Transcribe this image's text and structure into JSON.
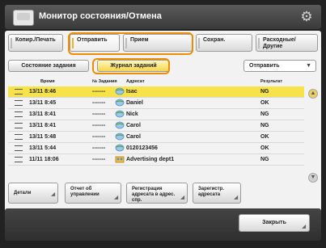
{
  "window": {
    "title": "Монитор состояния/Отмена"
  },
  "tabs": [
    {
      "label": "Копир./Печать"
    },
    {
      "label": "Отправить"
    },
    {
      "label": "Прием"
    },
    {
      "label": "Сохран."
    },
    {
      "label": "Расходные/ Другие"
    }
  ],
  "subbar": {
    "status_button": "Состояние задания",
    "log_button": "Журнал заданий",
    "filter_value": "Отправить"
  },
  "table": {
    "columns": [
      "Время",
      "№ Задания",
      "Адресат",
      "Результат"
    ],
    "rows": [
      {
        "time": "13/11 8:46",
        "job": "-------",
        "dest": "Isac",
        "result": "NG",
        "icon": "globe-icon",
        "selected": true
      },
      {
        "time": "13/11 8:45",
        "job": "-------",
        "dest": "Daniel",
        "result": "OK",
        "icon": "globe-icon",
        "selected": false
      },
      {
        "time": "13/11 8:41",
        "job": "-------",
        "dest": "Nick",
        "result": "NG",
        "icon": "globe-icon",
        "selected": false
      },
      {
        "time": "13/11 8:41",
        "job": "-------",
        "dest": "Carol",
        "result": "NG",
        "icon": "globe-icon",
        "selected": false
      },
      {
        "time": "13/11 5:48",
        "job": "-------",
        "dest": "Carol",
        "result": "OK",
        "icon": "globe-icon",
        "selected": false
      },
      {
        "time": "13/11 5:44",
        "job": "-------",
        "dest": "0120123456",
        "result": "OK",
        "icon": "globe-icon",
        "selected": false
      },
      {
        "time": "11/11 18:06",
        "job": "-------",
        "dest": "Advertising dept1",
        "result": "NG",
        "icon": "group-icon",
        "selected": false
      }
    ]
  },
  "actions": [
    {
      "label": "Детали"
    },
    {
      "label": "Отчет об управлении"
    },
    {
      "label": "Регистрация адресата в адрес. спр."
    },
    {
      "label": "Зарегистр. адресата"
    }
  ],
  "footer": {
    "close_label": "Закрыть"
  },
  "colors": {
    "accent_outline": "#f08c00",
    "selected_row": "#f7e24a"
  }
}
